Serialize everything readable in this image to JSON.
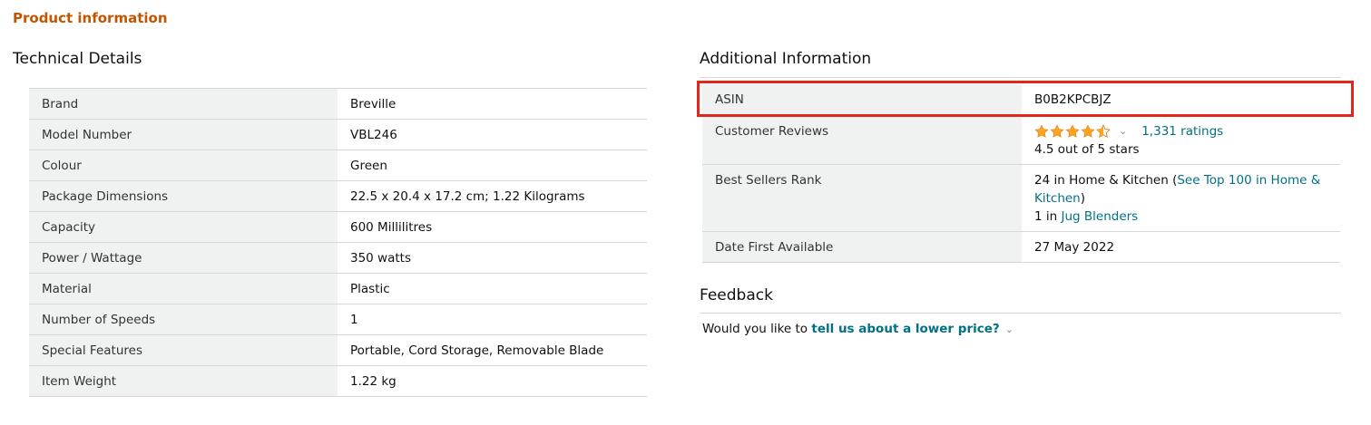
{
  "product_info": {
    "header": "Product information"
  },
  "technical_details": {
    "title": "Technical Details",
    "rows": [
      {
        "key": "Brand",
        "value": "Breville"
      },
      {
        "key": "Model Number",
        "value": "VBL246"
      },
      {
        "key": "Colour",
        "value": "Green"
      },
      {
        "key": "Package Dimensions",
        "value": "22.5 x 20.4 x 17.2 cm; 1.22 Kilograms"
      },
      {
        "key": "Capacity",
        "value": "600 Millilitres"
      },
      {
        "key": "Power / Wattage",
        "value": "350 watts"
      },
      {
        "key": "Material",
        "value": "Plastic"
      },
      {
        "key": "Number of Speeds",
        "value": "1"
      },
      {
        "key": "Special Features",
        "value": "Portable, Cord Storage, Removable Blade"
      },
      {
        "key": "Item Weight",
        "value": "1.22 kg"
      }
    ]
  },
  "additional_info": {
    "title": "Additional Information",
    "asin": {
      "key": "ASIN",
      "value": "B0B2KPCBJZ"
    },
    "reviews": {
      "key": "Customer Reviews",
      "rating": 4.5,
      "ratings_link": "1,331 ratings",
      "rating_text": "4.5 out of 5 stars"
    },
    "best_sellers": {
      "key": "Best Sellers Rank",
      "rank1_prefix": "24 in Home & Kitchen (",
      "rank1_link": "See Top 100 in Home & Kitchen",
      "rank1_suffix": ")",
      "rank2_prefix": "1 in ",
      "rank2_link": "Jug Blenders"
    },
    "date_first": {
      "key": "Date First Available",
      "value": "27 May 2022"
    }
  },
  "feedback": {
    "title": "Feedback",
    "prefix": "Would you like to ",
    "link": "tell us about a lower price?"
  },
  "colors": {
    "header_orange": "#c45500",
    "link_teal": "#007185",
    "star_orange": "#ffa41c",
    "highlight_red": "#e3261b",
    "key_bg": "#f0f2f2"
  }
}
